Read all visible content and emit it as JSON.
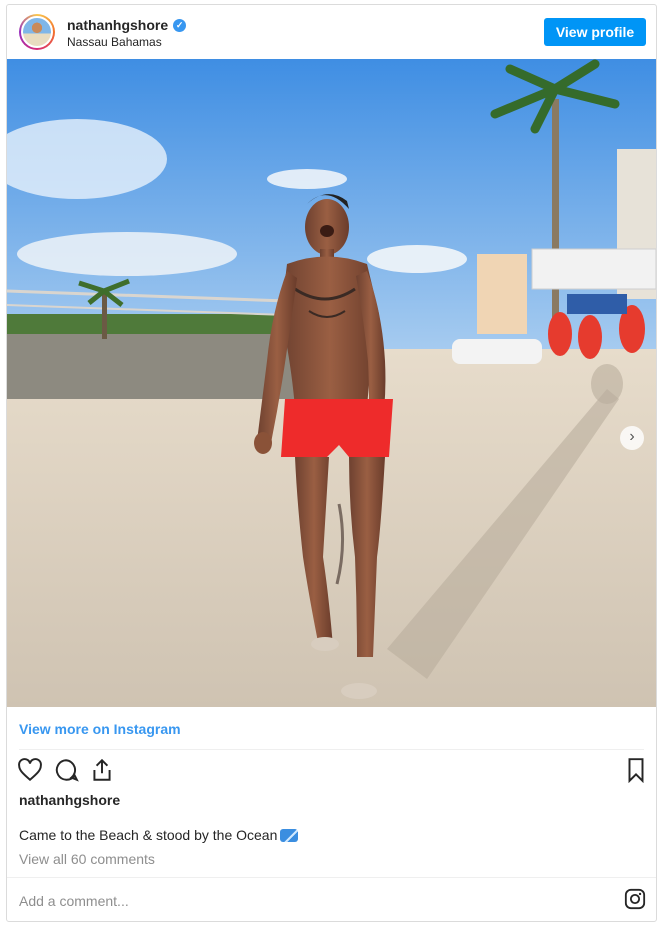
{
  "header": {
    "username": "nathanhgshore",
    "location": "Nassau Bahamas",
    "view_profile_label": "View profile"
  },
  "post": {
    "image_icon": "beach-photo",
    "carousel_next_icon": "chevron-right-icon",
    "view_more_label": "View more on Instagram",
    "caption_username": "nathanhgshore",
    "caption_text": "Came to the Beach & stood by the Ocean",
    "caption_emoji": "water-wave-emoji",
    "view_comments_label": "View all 60 comments",
    "add_comment_placeholder": "Add a comment..."
  },
  "colors": {
    "accent": "#0095f6",
    "link": "#3897f0",
    "muted": "#8e8e8e"
  }
}
